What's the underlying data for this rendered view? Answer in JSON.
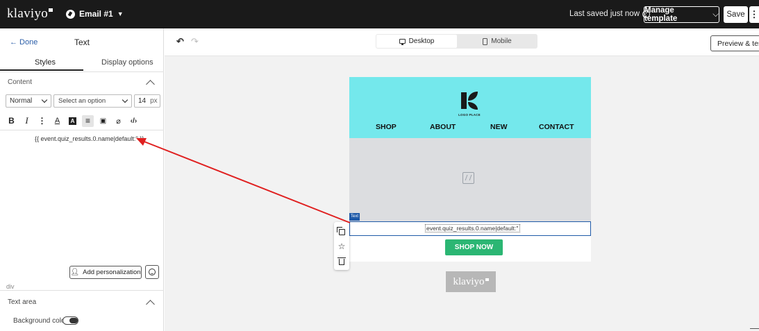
{
  "topbar": {
    "logo": "klaviyo",
    "email_name": "Email #1",
    "saved_status": "Last saved just now",
    "manage_template": "Manage template",
    "save": "Save",
    "more": "⋮"
  },
  "left_panel": {
    "done": "← Done",
    "title": "Text",
    "tabs": [
      "Styles",
      "Display options"
    ],
    "content_section": "Content",
    "style_select": "Normal",
    "font_select_placeholder": "Select an option",
    "font_size": "14",
    "font_size_unit": "px",
    "editor_text": "{{ event.quiz_results.0.name|default:'' }}",
    "add_personalization": "Add personalization",
    "element_tag": "div",
    "text_area_section": "Text area",
    "background_color_label": "Background color"
  },
  "canvas": {
    "device_desktop": "Desktop",
    "device_mobile": "Mobile",
    "preview_test": "Preview & test"
  },
  "email": {
    "logo_text": "LOGO PLACE",
    "nav": [
      "SHOP",
      "ABOUT",
      "NEW",
      "CONTACT"
    ],
    "text_tag": "Text",
    "text_content": "event.quiz_results.0.name|default:''",
    "button": "SHOP NOW",
    "footer_logo": "klaviyo"
  },
  "colors": {
    "header_bg": "#1a1a1a",
    "email_hero_bg": "#74e8ec",
    "shop_now_bg": "#2bb673",
    "selection_blue": "#1f5aa8",
    "annotation_arrow": "#e02020"
  }
}
